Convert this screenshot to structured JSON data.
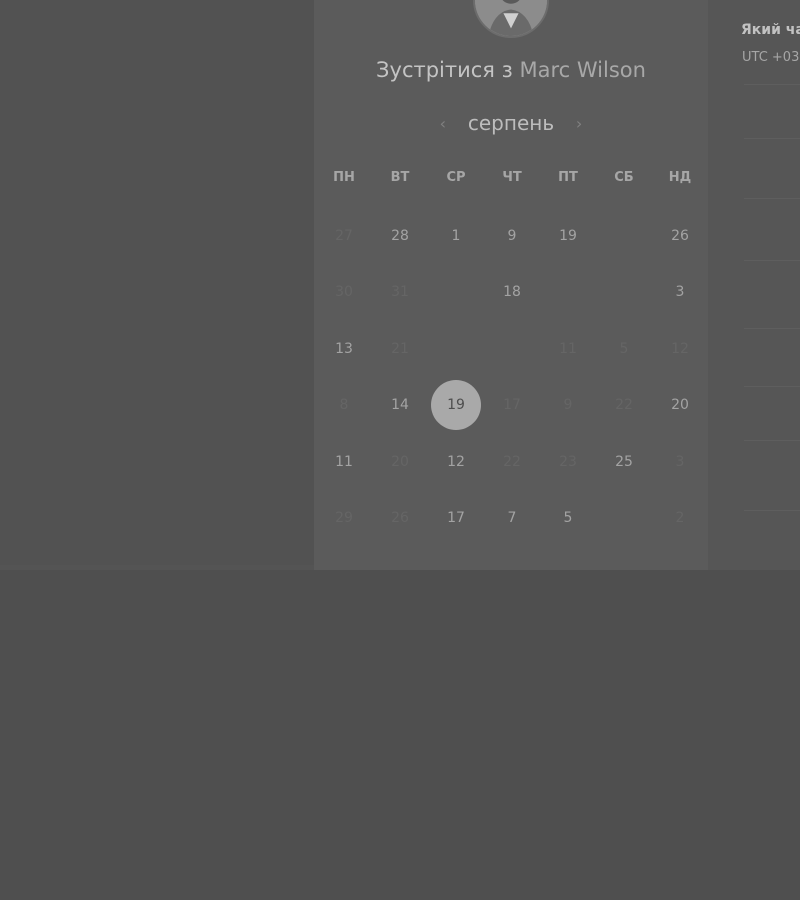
{
  "meeting": {
    "title_prefix": "Зустрітися з",
    "host_name": "Marc Wilson"
  },
  "calendar": {
    "month": "серпень",
    "prev_icon": "chevron-left-icon",
    "next_icon": "chevron-right-icon",
    "weekdays": [
      "ПН",
      "ВТ",
      "СР",
      "ЧТ",
      "ПТ",
      "СБ",
      "НД"
    ],
    "weeks": [
      [
        {
          "d": "27",
          "dim": true
        },
        {
          "d": "28"
        },
        {
          "d": "1"
        },
        {
          "d": "9"
        },
        {
          "d": "19"
        },
        {
          "d": "",
          "dim": true
        },
        {
          "d": "26"
        }
      ],
      [
        {
          "d": "30",
          "dim": true
        },
        {
          "d": "31",
          "dim": true
        },
        {
          "d": "",
          "dim": true
        },
        {
          "d": "18"
        },
        {
          "d": "",
          "dim": true
        },
        {
          "d": "",
          "dim": true
        },
        {
          "d": "3"
        }
      ],
      [
        {
          "d": "13"
        },
        {
          "d": "21",
          "dim": true
        },
        {
          "d": "",
          "dim": true
        },
        {
          "d": "",
          "dim": true
        },
        {
          "d": "11",
          "dim": true
        },
        {
          "d": "5",
          "dim": true
        },
        {
          "d": "12",
          "dim": true
        }
      ],
      [
        {
          "d": "8",
          "dim": true
        },
        {
          "d": "14"
        },
        {
          "d": "19",
          "selected": true
        },
        {
          "d": "17",
          "dim": true
        },
        {
          "d": "9",
          "dim": true
        },
        {
          "d": "22",
          "dim": true
        },
        {
          "d": "20"
        }
      ],
      [
        {
          "d": "11"
        },
        {
          "d": "20",
          "dim": true
        },
        {
          "d": "12"
        },
        {
          "d": "22",
          "dim": true
        },
        {
          "d": "23",
          "dim": true
        },
        {
          "d": "25"
        },
        {
          "d": "3",
          "dim": true
        }
      ],
      [
        {
          "d": "29",
          "dim": true
        },
        {
          "d": "26",
          "dim": true
        },
        {
          "d": "17"
        },
        {
          "d": "7"
        },
        {
          "d": "5"
        },
        {
          "d": "",
          "dim": true
        },
        {
          "d": "2",
          "dim": true
        }
      ]
    ]
  },
  "time_panel": {
    "question": "Який ча",
    "timezone": "UTC +03"
  },
  "avatar": {
    "icon": "person-avatar-icon"
  }
}
